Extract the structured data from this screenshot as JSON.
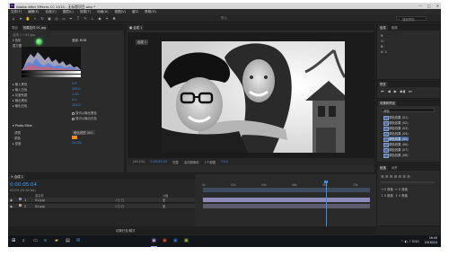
{
  "window": {
    "title": "Adobe After Effects CC 2015 - 无标题项目.aep *",
    "logo": "Ae",
    "controls": [
      "—",
      "□",
      "✕"
    ]
  },
  "menu": [
    "文件(F)",
    "编辑(E)",
    "合成(C)",
    "图层(L)",
    "效果(T)",
    "动画(A)",
    "视图(V)",
    "窗口",
    "帮助(H)"
  ],
  "toolbar": {
    "tools": [
      "home-icon",
      "arrow-icon",
      "hand-icon",
      "zoom-icon",
      "rotate-icon",
      "camera-icon",
      "pan-behind-icon",
      "rect-mask-icon",
      "pen-icon",
      "text-icon",
      "brush-icon",
      "clone-icon",
      "eraser-icon",
      "roto-icon",
      "puppet-icon"
    ],
    "workspace_label": "默认",
    "search_placeholder": "搜索帮助"
  },
  "effects_panel": {
    "tabs": [
      "项目",
      "效果控件 01.jpg"
    ],
    "breadcrumb": "合成 1 • 01.jpg",
    "effect_name": "色阶",
    "channel_label": "通道:",
    "channel_value": "RGB",
    "histogram_label": "直方图",
    "rows": [
      {
        "label": "输入黑色",
        "value": "0.0"
      },
      {
        "label": "输入白色",
        "value": "255.0"
      },
      {
        "label": "灰度系数",
        "value": "1.00"
      },
      {
        "label": "输出黑色",
        "value": "0.0"
      },
      {
        "label": "输出白色",
        "value": "255.0"
      }
    ],
    "clip_black": "剪切以输出黑色",
    "clip_white": "剪切以输出白色",
    "photo_filter": "Photo Filter",
    "filter_label": "滤镜",
    "filter_value": "暖色滤镜 (85)",
    "color_label": "颜色",
    "density_label": "密度",
    "density_value": "25.0%"
  },
  "composition": {
    "tab": "合成 1",
    "status": {
      "zoom": "(50.1%)",
      "timecode": "0:00:05:04",
      "resolution": "完整",
      "camera": "活动摄像机",
      "views": "1个视图",
      "offset": "+0.0"
    }
  },
  "right_panels": {
    "info_tab": "信息",
    "audio_tab": "音频",
    "info_rows": [
      "R:",
      "G:",
      "B:",
      "A: 0"
    ],
    "preview_tab": "预览",
    "effects_tab": "效果和预设",
    "effects_search": "调色",
    "effect_items": [
      "调色效果 (01)",
      "调色效果 (02)",
      "调色效果 (03)",
      "调色效果 (04)",
      "调色效果 (05)",
      "调色效果 (06)",
      "调色效果 (07)",
      "调色效果 (08)"
    ],
    "paragraph_tab": "段落",
    "align_tab": "对齐"
  },
  "timeline": {
    "tab": "合成 1",
    "timecode": "0:00:05:04",
    "fps": "00129 (25.00 fps)",
    "col_source": "源名称",
    "col_parent": "父级",
    "layers": [
      {
        "index": "1",
        "name": "01.jpg",
        "parent": "无",
        "color": "#8a8ab8"
      },
      {
        "index": "2",
        "name": "02.jpg",
        "parent": "无",
        "color": "#b89a8a"
      }
    ],
    "ruler": [
      "0s",
      "02s",
      "04s",
      "06s",
      "08s",
      "10s"
    ],
    "footer": "切换开关/模式"
  },
  "taskbar": {
    "start": "⊞",
    "clock_time": "16:45",
    "clock_date": "2016/2/4",
    "tray": "ENG"
  },
  "colors": {
    "accent_blue": "#3a8ee6",
    "panel_bg": "#2b2b2b",
    "dark_bg": "#232323",
    "layer1_bar": "#8a8ab8",
    "layer2_bar": "#5b5b6b"
  }
}
